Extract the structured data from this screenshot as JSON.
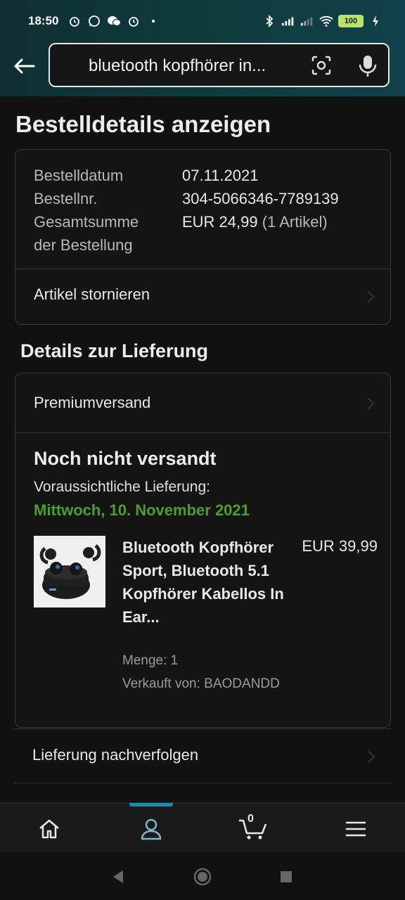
{
  "status_bar": {
    "time": "18:50",
    "left_icons": [
      "alarm-icon",
      "whatsapp-icon",
      "wechat-icon",
      "alarm-icon",
      "dot-icon"
    ],
    "right_icons": [
      "bluetooth-icon",
      "signal-icon",
      "signal-icon",
      "wifi-icon"
    ],
    "battery": "100"
  },
  "search": {
    "query": "bluetooth kopfhörer in..."
  },
  "page": {
    "title": "Bestelldetails anzeigen"
  },
  "order": {
    "date_label": "Bestelldatum",
    "date_value": "07.11.2021",
    "number_label": "Bestellnr.",
    "number_value": "304-5066346-7789139",
    "total_label_line1": "Gesamtsumme",
    "total_label_line2": "der Bestellung",
    "total_value": "EUR 24,99",
    "total_items": "(1 Artikel)",
    "cancel_label": "Artikel stornieren"
  },
  "delivery": {
    "section_title": "Details zur Lieferung",
    "shipping_method": "Premiumversand",
    "status": "Noch nicht versandt",
    "eta_label": "Voraussichtliche Lieferung:",
    "eta_date": "Mittwoch, 10. November 2021",
    "product": {
      "title": "Bluetooth Kopfhörer Sport, Bluetooth 5.1 Kopfhörer Kabellos In Ear...",
      "price": "EUR 39,99",
      "quantity": "Menge: 1",
      "seller": "Verkauft von: BAODANDD"
    },
    "track_label": "Lieferung nachverfolgen"
  },
  "bottom_nav": {
    "items": [
      "home-icon",
      "account-icon",
      "cart-icon",
      "menu-icon"
    ],
    "cart_count": "0",
    "accent": "#1e8aa3"
  },
  "colors": {
    "eta_green": "#4d9e2f",
    "background": "#111111"
  }
}
